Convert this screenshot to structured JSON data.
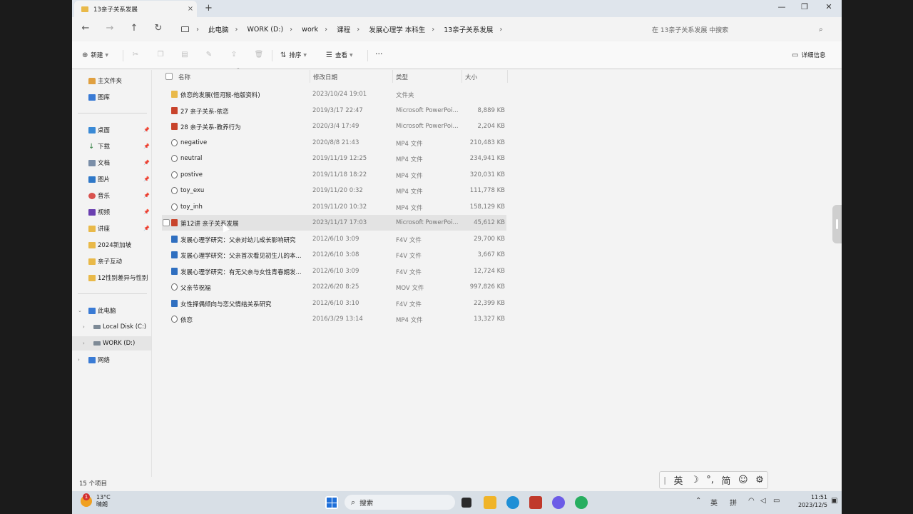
{
  "window": {
    "tab_title": "13亲子关系发展",
    "tab_close": "×",
    "new_tab": "+",
    "controls": {
      "minimize": "—",
      "maximize": "❐",
      "close": "✕"
    }
  },
  "nav": {
    "back": "←",
    "forward": "→",
    "up": "↑",
    "refresh": "↻",
    "breadcrumbs": [
      "此电脑",
      "WORK (D:)",
      "work",
      "课程",
      "发展心理学 本科生",
      "13亲子关系发展"
    ],
    "crumb_sep": "›",
    "search_placeholder": "在 13亲子关系发展 中搜索"
  },
  "toolbar": {
    "new_label": "新建",
    "sort_label": "排序",
    "view_label": "查看",
    "more_label": "···",
    "details_label": "详细信息"
  },
  "sidebar": {
    "home": "主文件夹",
    "gallery": "图库",
    "quick": [
      "桌面",
      "下载",
      "文档",
      "图片",
      "音乐",
      "视频",
      "讲座",
      "2024新加坡",
      "亲子互动",
      "12性别差异与性别"
    ],
    "this_pc": "此电脑",
    "drives": [
      "Local Disk (C:)",
      "WORK (D:)"
    ],
    "network": "网络"
  },
  "columns": {
    "name": "名称",
    "date": "修改日期",
    "type": "类型",
    "size": "大小"
  },
  "files": [
    {
      "name": "依恋的发展(恒河猴-他版资料)",
      "date": "2023/10/24 19:01",
      "type": "文件夹",
      "size": "",
      "kind": "folder"
    },
    {
      "name": "27 亲子关系-依恋",
      "date": "2019/3/17 22:47",
      "type": "Microsoft PowerPoi...",
      "size": "8,889 KB",
      "kind": "ppt"
    },
    {
      "name": "28 亲子关系-教养行为",
      "date": "2020/3/4 17:49",
      "type": "Microsoft PowerPoi...",
      "size": "2,204 KB",
      "kind": "ppt"
    },
    {
      "name": "negative",
      "date": "2020/8/8 21:43",
      "type": "MP4 文件",
      "size": "210,483 KB",
      "kind": "video"
    },
    {
      "name": "neutral",
      "date": "2019/11/19 12:25",
      "type": "MP4 文件",
      "size": "234,941 KB",
      "kind": "video"
    },
    {
      "name": "postive",
      "date": "2019/11/18 18:22",
      "type": "MP4 文件",
      "size": "320,031 KB",
      "kind": "video"
    },
    {
      "name": "toy_exu",
      "date": "2019/11/20 0:32",
      "type": "MP4 文件",
      "size": "111,778 KB",
      "kind": "video"
    },
    {
      "name": "toy_inh",
      "date": "2019/11/20 10:32",
      "type": "MP4 文件",
      "size": "158,129 KB",
      "kind": "video"
    },
    {
      "name": "第12讲 亲子关系发展",
      "date": "2023/11/17 17:03",
      "type": "Microsoft PowerPoi...",
      "size": "45,612 KB",
      "kind": "ppt"
    },
    {
      "name": "发展心理学研究：父亲对幼儿成长影响研究",
      "date": "2012/6/10 3:09",
      "type": "F4V 文件",
      "size": "29,700 KB",
      "kind": "f4v"
    },
    {
      "name": "发展心理学研究：父亲首次看见初生儿的本...",
      "date": "2012/6/10 3:08",
      "type": "F4V 文件",
      "size": "3,667 KB",
      "kind": "f4v"
    },
    {
      "name": "发展心理学研究：有无父亲与女性青春期发...",
      "date": "2012/6/10 3:09",
      "type": "F4V 文件",
      "size": "12,724 KB",
      "kind": "f4v"
    },
    {
      "name": "父亲节祝福",
      "date": "2022/6/20 8:25",
      "type": "MOV 文件",
      "size": "997,826 KB",
      "kind": "video"
    },
    {
      "name": "女性择偶倾向与恋父情结关系研究",
      "date": "2012/6/10 3:10",
      "type": "F4V 文件",
      "size": "22,399 KB",
      "kind": "f4v"
    },
    {
      "name": "依恋",
      "date": "2016/3/29 13:14",
      "type": "MP4 文件",
      "size": "13,327 KB",
      "kind": "video"
    }
  ],
  "status": {
    "count": "15 个项目"
  },
  "ime": {
    "lang": "英",
    "mode": "简"
  },
  "taskbar": {
    "badge": "1",
    "temp": "13°C",
    "weather": "晴朗",
    "search": "搜索",
    "tray_lang": "英",
    "tray_ime": "拼",
    "time": "11:51",
    "date": "2023/12/5"
  },
  "colors": {
    "folder": "#e9b949",
    "ppt": "#c8432b",
    "video": "#5a5a5a",
    "f4v": "#2f6fc0",
    "selected": "#e3e3e3"
  }
}
